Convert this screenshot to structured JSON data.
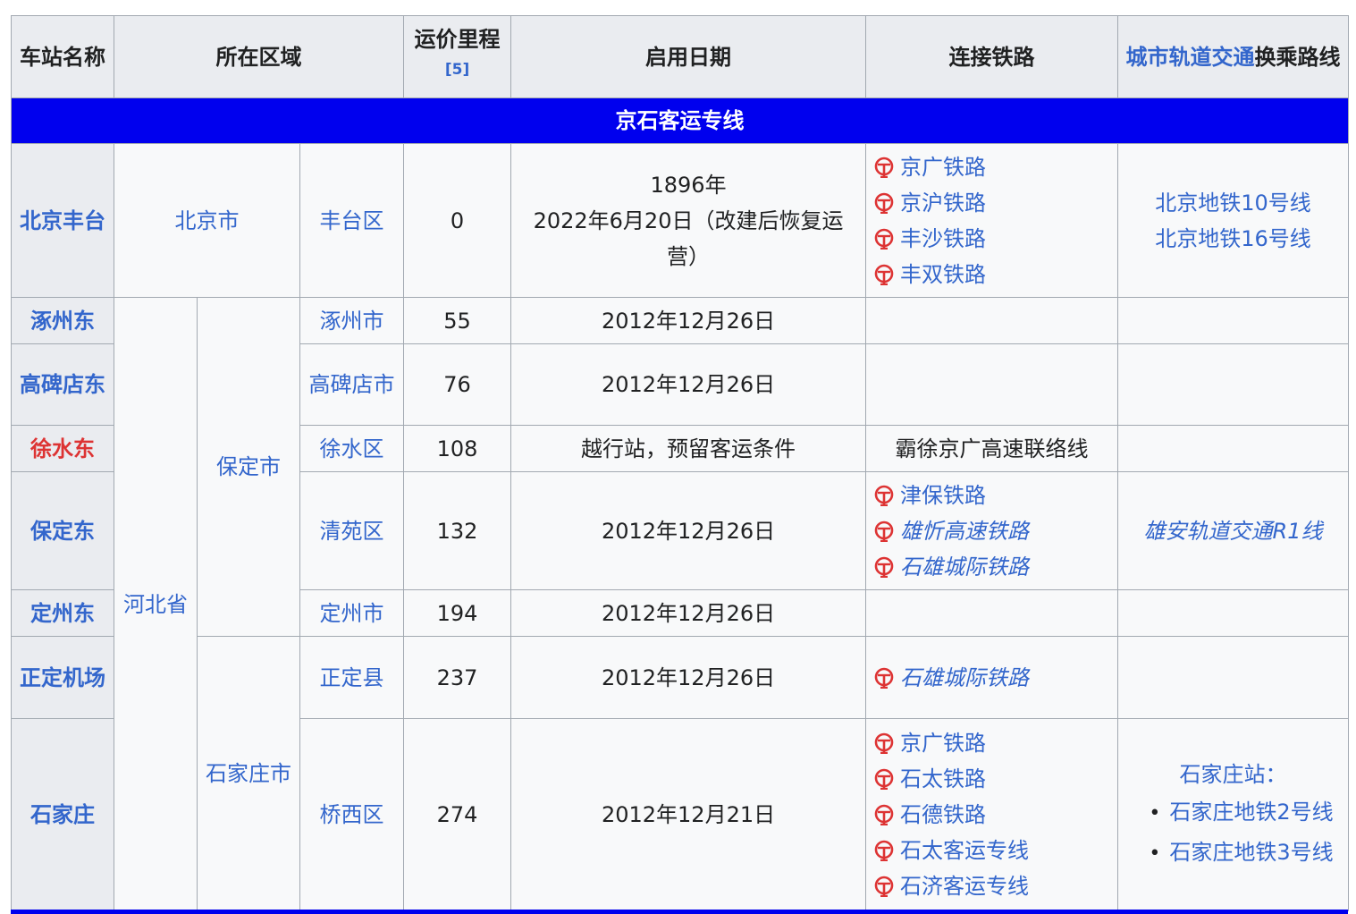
{
  "header": {
    "station": "车站名称",
    "region": "所在区域",
    "distance": "运价里程",
    "distance_ref": "[5]",
    "open_date": "启用日期",
    "railways": "连接铁路",
    "metro_link": "城市轨道交通",
    "metro_rest": "换乘路线"
  },
  "section": "京石客运专线",
  "colors": {
    "section_bar": "#0000ee",
    "link": "#3366cc",
    "red_station": "#d33",
    "rail_icon": "#d33"
  },
  "rows": [
    {
      "station": "北京丰台",
      "province": "北京市",
      "district": "丰台区",
      "km": "0",
      "date_lines": [
        "1896年",
        "2022年6月20日（改建后恢复运营）"
      ],
      "rails": [
        "京广铁路",
        "京沪铁路",
        "丰沙铁路",
        "丰双铁路"
      ],
      "metro": [
        "北京地铁10号线",
        "北京地铁16号线"
      ]
    },
    {
      "station": "涿州东",
      "province": "河北省",
      "city": "保定市",
      "district": "涿州市",
      "km": "55",
      "date": "2012年12月26日"
    },
    {
      "station": "高碑店东",
      "district": "高碑店市",
      "km": "76",
      "date": "2012年12月26日"
    },
    {
      "station": "徐水东",
      "district": "徐水区",
      "km": "108",
      "date": "越行站，预留客运条件",
      "rail_text": "霸徐京广高速联络线"
    },
    {
      "station": "保定东",
      "district": "清苑区",
      "km": "132",
      "date": "2012年12月26日",
      "rails": [
        "津保铁路",
        "雄忻高速铁路",
        "石雄城际铁路"
      ],
      "metro": "雄安轨道交通R1线"
    },
    {
      "station": "定州东",
      "district": "定州市",
      "km": "194",
      "date": "2012年12月26日"
    },
    {
      "station": "正定机场",
      "city": "石家庄市",
      "district": "正定县",
      "km": "237",
      "date": "2012年12月26日",
      "rails": [
        "石雄城际铁路"
      ]
    },
    {
      "station": "石家庄",
      "district": "桥西区",
      "km": "274",
      "date": "2012年12月21日",
      "rails": [
        "京广铁路",
        "石太铁路",
        "石德铁路",
        "石太客运专线",
        "石济客运专线"
      ],
      "metro_label": "石家庄站：",
      "metro": [
        "石家庄地铁2号线",
        "石家庄地铁3号线"
      ]
    }
  ]
}
